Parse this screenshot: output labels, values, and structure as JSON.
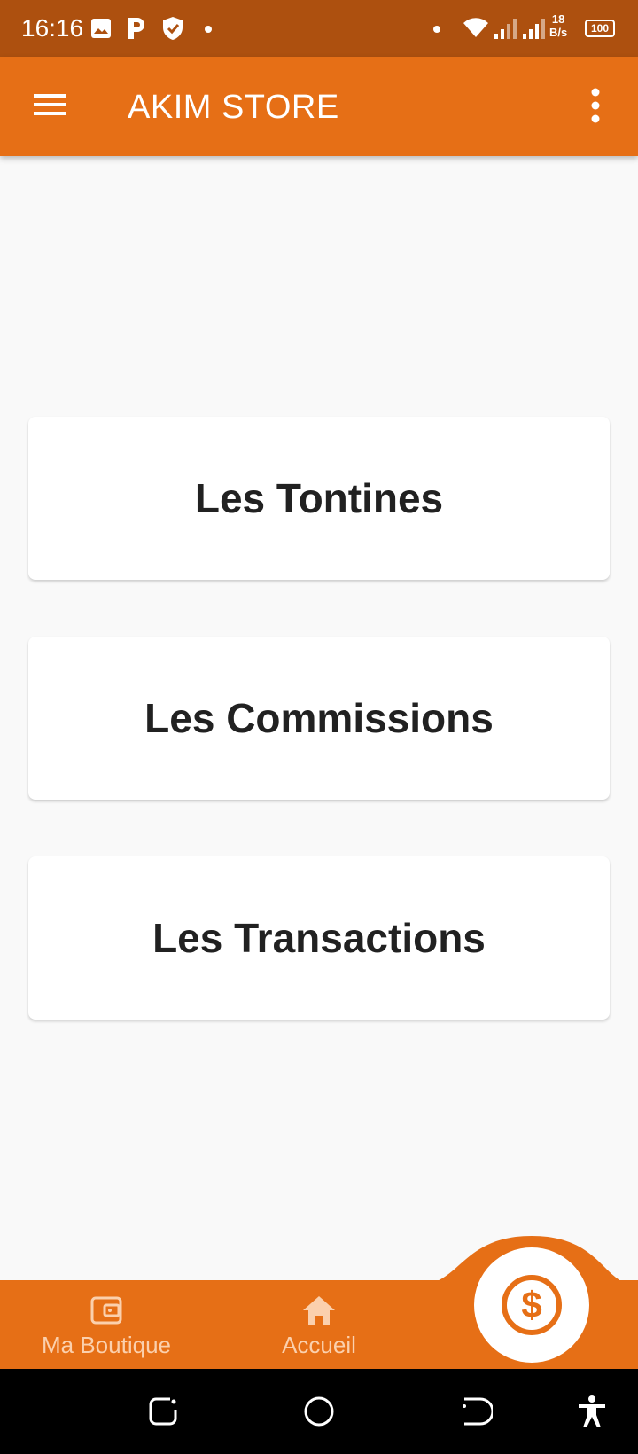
{
  "status_bar": {
    "time": "16:16",
    "speed_value": "18",
    "speed_unit": "B/s",
    "battery": "100",
    "icons": [
      "image-icon",
      "p-app-icon",
      "shield-icon",
      "dot-icon",
      "dot-icon",
      "wifi-icon",
      "signal-icon",
      "signal-icon"
    ]
  },
  "app_bar": {
    "title": "AKIM STORE",
    "icons": [
      "menu-icon",
      "more-vert-icon"
    ]
  },
  "cards": [
    {
      "label": "Les Tontines"
    },
    {
      "label": "Les Commissions"
    },
    {
      "label": "Les Transactions"
    }
  ],
  "bottom_nav": {
    "items": [
      {
        "label": "Ma Boutique",
        "icon": "wallet-icon"
      },
      {
        "label": "Accueil",
        "icon": "home-icon"
      }
    ],
    "fab_icon": "dollar-icon"
  },
  "system_nav": {
    "icons": [
      "recents-icon",
      "home-circle-icon",
      "back-icon",
      "accessibility-icon"
    ]
  },
  "colors": {
    "status_bar": "#ad500f",
    "primary": "#e66f16",
    "background": "#f9f9f9",
    "nav_text": "#fbd0ad"
  }
}
